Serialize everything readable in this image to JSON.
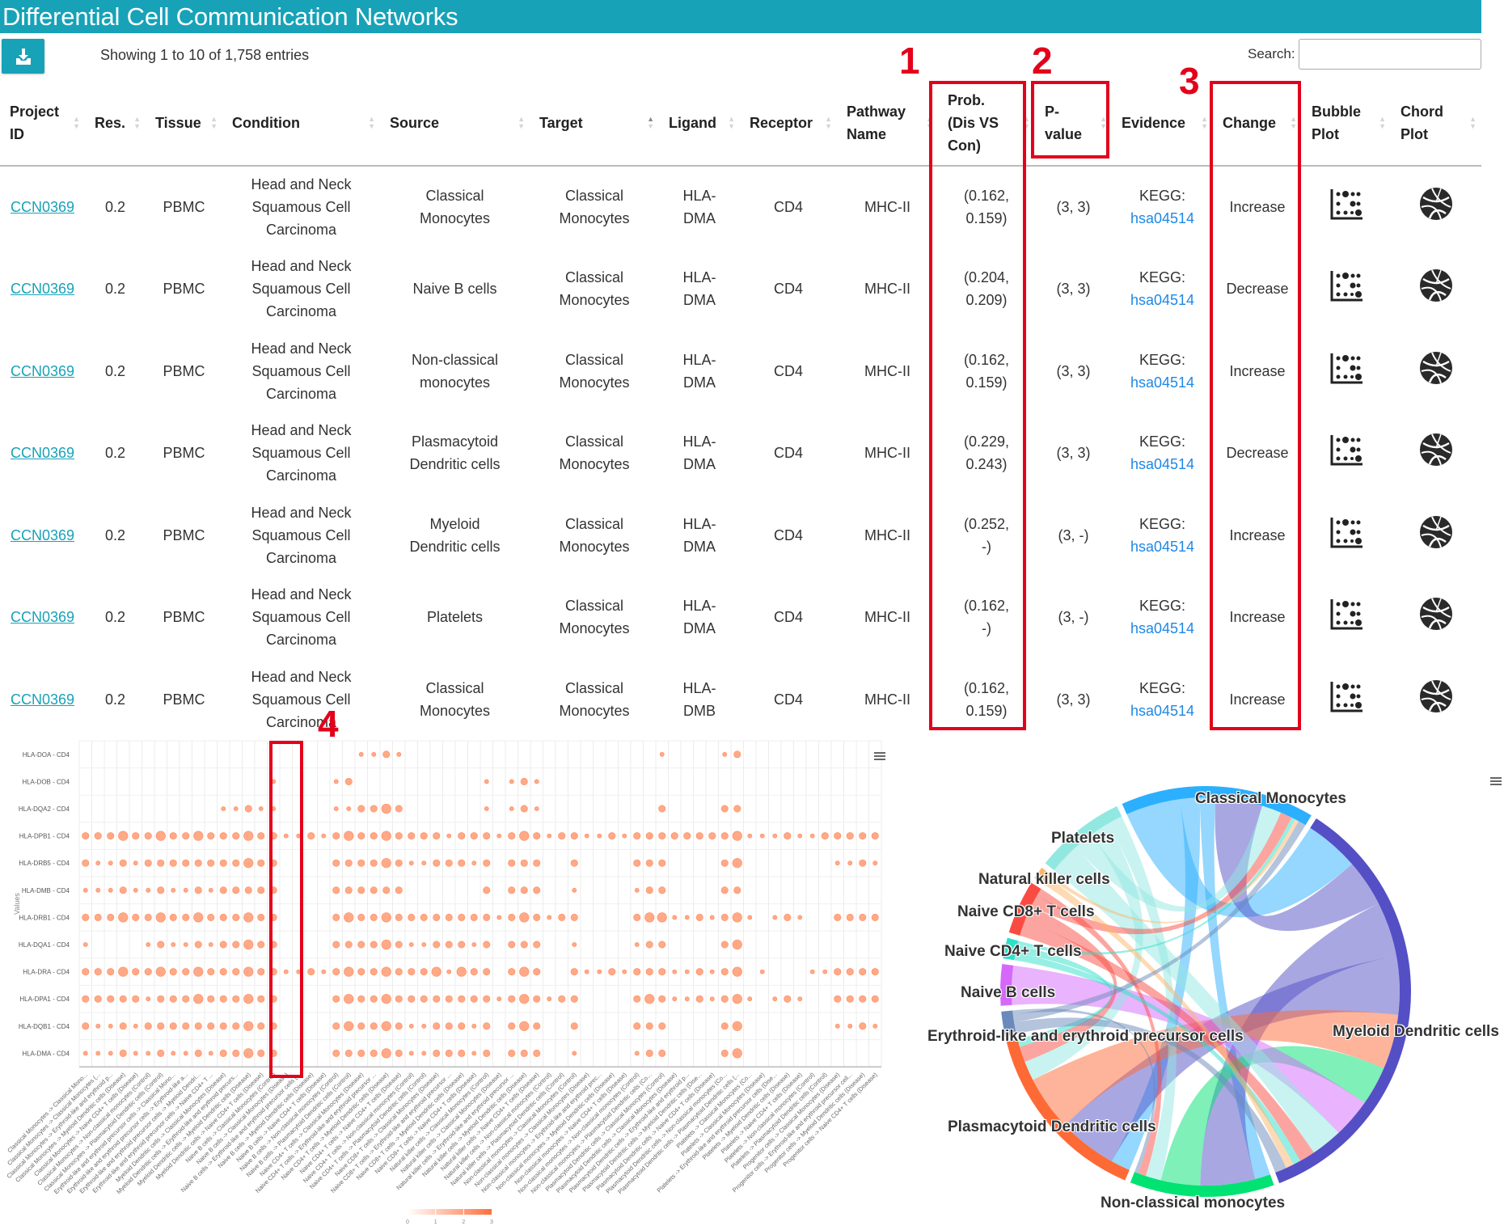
{
  "header": {
    "title": "Differential Cell Communication Networks"
  },
  "toolbar": {
    "download_icon": "download-icon",
    "info": "Showing 1 to 10 of 1,758 entries",
    "search_label": "Search:",
    "search_value": ""
  },
  "table": {
    "columns": [
      "Project ID",
      "Res.",
      "Tissue",
      "Condition",
      "Source",
      "Target",
      "Ligand",
      "Receptor",
      "Pathway Name",
      "Prob. (Dis VS Con)",
      "P-value",
      "Evidence",
      "Change",
      "Bubble Plot",
      "Chord Plot"
    ],
    "sorted_column": "Target",
    "sort_direction": "ascending",
    "rows": [
      {
        "project_id": "CCN0369",
        "res": "0.2",
        "tissue": "PBMC",
        "condition": "Head and Neck Squamous Cell Carcinoma",
        "source": "Classical Monocytes",
        "target": "Classical Monocytes",
        "ligand": "HLA-DMA",
        "receptor": "CD4",
        "pathway": "MHC-II",
        "prob": "(0.162, 0.159)",
        "pvalue": "(3, 3)",
        "evidence_prefix": "KEGG:",
        "evidence_link": "hsa04514",
        "change": "Increase"
      },
      {
        "project_id": "CCN0369",
        "res": "0.2",
        "tissue": "PBMC",
        "condition": "Head and Neck Squamous Cell Carcinoma",
        "source": "Naive B cells",
        "target": "Classical Monocytes",
        "ligand": "HLA-DMA",
        "receptor": "CD4",
        "pathway": "MHC-II",
        "prob": "(0.204, 0.209)",
        "pvalue": "(3, 3)",
        "evidence_prefix": "KEGG:",
        "evidence_link": "hsa04514",
        "change": "Decrease"
      },
      {
        "project_id": "CCN0369",
        "res": "0.2",
        "tissue": "PBMC",
        "condition": "Head and Neck Squamous Cell Carcinoma",
        "source": "Non-classical monocytes",
        "target": "Classical Monocytes",
        "ligand": "HLA-DMA",
        "receptor": "CD4",
        "pathway": "MHC-II",
        "prob": "(0.162, 0.159)",
        "pvalue": "(3, 3)",
        "evidence_prefix": "KEGG:",
        "evidence_link": "hsa04514",
        "change": "Increase"
      },
      {
        "project_id": "CCN0369",
        "res": "0.2",
        "tissue": "PBMC",
        "condition": "Head and Neck Squamous Cell Carcinoma",
        "source": "Plasmacytoid Dendritic cells",
        "target": "Classical Monocytes",
        "ligand": "HLA-DMA",
        "receptor": "CD4",
        "pathway": "MHC-II",
        "prob": "(0.229, 0.243)",
        "pvalue": "(3, 3)",
        "evidence_prefix": "KEGG:",
        "evidence_link": "hsa04514",
        "change": "Decrease"
      },
      {
        "project_id": "CCN0369",
        "res": "0.2",
        "tissue": "PBMC",
        "condition": "Head and Neck Squamous Cell Carcinoma",
        "source": "Myeloid Dendritic cells",
        "target": "Classical Monocytes",
        "ligand": "HLA-DMA",
        "receptor": "CD4",
        "pathway": "MHC-II",
        "prob": "(0.252, -)",
        "pvalue": "(3, -)",
        "evidence_prefix": "KEGG:",
        "evidence_link": "hsa04514",
        "change": "Increase"
      },
      {
        "project_id": "CCN0369",
        "res": "0.2",
        "tissue": "PBMC",
        "condition": "Head and Neck Squamous Cell Carcinoma",
        "source": "Platelets",
        "target": "Classical Monocytes",
        "ligand": "HLA-DMA",
        "receptor": "CD4",
        "pathway": "MHC-II",
        "prob": "(0.162, -)",
        "pvalue": "(3, -)",
        "evidence_prefix": "KEGG:",
        "evidence_link": "hsa04514",
        "change": "Increase"
      },
      {
        "project_id": "CCN0369",
        "res": "0.2",
        "tissue": "PBMC",
        "condition": "Head and Neck Squamous Cell Carcinoma",
        "source": "Classical Monocytes",
        "target": "Classical Monocytes",
        "ligand": "HLA-DMB",
        "receptor": "CD4",
        "pathway": "MHC-II",
        "prob": "(0.162, 0.159)",
        "pvalue": "(3, 3)",
        "evidence_prefix": "KEGG:",
        "evidence_link": "hsa04514",
        "change": "Increase"
      }
    ],
    "row_icons": {
      "bubble": "bubble-plot-icon",
      "chord": "chord-plot-icon"
    }
  },
  "annotations": {
    "labels": [
      "1",
      "2",
      "3",
      "4"
    ],
    "color": "#e3001b"
  },
  "chart_data": [
    {
      "type": "scatter",
      "subtype": "bubble",
      "ylabel": "Values",
      "bubble_color": "#ffa07a",
      "colorbar": {
        "ticks": [
          "0",
          "1",
          "2",
          "3"
        ],
        "range": [
          0,
          3
        ],
        "color_low": "#ffffff",
        "color_high": "#ff6f3c"
      },
      "grid": true,
      "y_categories": [
        "HLA-DOA - CD4",
        "HLA-DOB - CD4",
        "HLA-DQA2 - CD4",
        "HLA-DPB1 - CD4",
        "HLA-DRB5 - CD4",
        "HLA-DMB - CD4",
        "HLA-DRB1 - CD4",
        "HLA-DQA1 - CD4",
        "HLA-DRA - CD4",
        "HLA-DPA1 - CD4",
        "HLA-DQB1 - CD4",
        "HLA-DMA - CD4"
      ],
      "x_categories": [
        "Classical Monocytes -> Classical Mono...",
        "Classical Monocytes -> Classical Monocytes (...",
        "Classical Monocytes -> Erythroid-like and erythroid p...",
        "Classical Monocytes -> Myeloid Dendritic cells (Disease)",
        "Classical Monocytes -> Naive CD4+ T cells (Disease)",
        "Classical Monocytes -> Non-classical monocytes (Control)",
        "Classical Monocytes -> Plasmacytoid Dendritic cells (Control)",
        "Erythroid-like and erythroid precursor cells -> Classical Mono...",
        "Erythroid-like and erythroid precursor cells -> Erythroid-like a...",
        "Erythroid-like and erythroid precursor cells -> Myeloid Dendri...",
        "Erythroid-like and erythroid precursor cells -> Naive CD4+ T ...",
        "Myeloid Dendritic cells -> Classical Monocytes (Disease)",
        "Myeloid Dendritic cells -> Erythroid-like and erythroid precurs...",
        "Myeloid Dendritic cells -> Myeloid Dendritic cells (Disease)",
        "Myeloid Dendritic cells -> Naive CD4+ T cells (Disease)",
        "Naive B cells -> Classical Monocytes (Control)",
        "Naive B cells -> Classical Monocytes (Disease)",
        "Naive B cells -> Erythroid-like and erythroid precursor cells (...",
        "Naive B cells -> Myeloid Dendritic cells (Disease)",
        "Naive B cells -> Naive CD4+ T cells (Disease)",
        "Naive B cells -> Non-classical monocytes (Control)",
        "Naive B cells -> Plasmacytoid Dendritic cells (Control)",
        "Naive CD4+ T cells -> Classical Monocytes (Disease)",
        "Naive CD4+ T cells -> Erythroid-like and erythroid precursor ...",
        "Naive CD4+ T cells -> Myeloid Dendritic cells (Disease)",
        "Naive CD4+ T cells -> Naive CD4+ T cells (Disease)",
        "Naive CD4+ T cells -> Non-classical monocytes (Control)",
        "Naive CD4+ T cells -> Plasmacytoid Dendritic cells (Control)",
        "Naive CD8+ T cells -> Classical Monocytes (Disease)",
        "Naive CD8+ T cells -> Erythroid-like and erythroid precursor ...",
        "Naive CD8+ T cells -> Myeloid Dendritic cells (Disease)",
        "Naive CD8+ T cells -> Naive CD4+ T cells (Disease)",
        "Natural killer cells -> Classical Monocytes (Control)",
        "Natural killer cells -> Classical Monocytes (Disease)",
        "Natural killer cells -> Erythroid-like and erythroid precursor ...",
        "Natural killer cells -> Myeloid Dendritic cells (Disease)",
        "Natural killer cells -> Naive CD4+ T cells (Disease)",
        "Natural killer cells -> Non-classical monocytes (Control)",
        "Natural killer cells -> Plasmacytoid Dendritic cells (Control)",
        "Non-classical monocytes -> Classical Monocytes (Control)",
        "Non-classical monocytes -> Classical Monocytes (Disease)",
        "Non-classical monocytes -> Erythroid-like and erythroid prec...",
        "Non-classical monocytes -> Myeloid Dendritic cells (Disease)",
        "Non-classical monocytes -> Naive CD4+ T cells (Disease)",
        "Non-classical monocytes -> Non-classical monocytes (Control)",
        "Non-classical monocytes -> Plasmacytoid Dendritic cells (Co...",
        "Plasmacytoid Dendritic cells -> Classical Monocytes (Control)",
        "Plasmacytoid Dendritic cells -> Classical Monocytes (Disease)",
        "Plasmacytoid Dendritic cells -> Erythroid-like and erythroid p...",
        "Plasmacytoid Dendritic cells -> Myeloid Dendritic cells (Dise...",
        "Plasmacytoid Dendritic cells -> Naive CD4+ T cells (Disease)",
        "Plasmacytoid Dendritic cells -> Non-classical monocytes (Co...",
        "Plasmacytoid Dendritic cells -> Plasmacytoid Dendritic cells (...",
        "Platelets -> Classical Monocytes (Co...",
        "Platelets -> Classical Monocytes (Disease)",
        "Platelets -> Erythroid-like and erythroid precursor cells (Dise...",
        "Platelets -> Myeloid Dendritic cells (Disease)",
        "Platelets -> Naive CD4+ T cells (Disease)",
        "Platelets -> Non-classical monocytes (Control)",
        "Platelets -> Plasmacytoid Dendritic cells (Control)",
        "Progenitor cells -> Classical Monocytes (Disease)",
        "Progenitor cells -> Erythroid-like and erythroid precursor cell...",
        "Progenitor cells -> Myeloid Dendritic cells (Disease)",
        "Progenitor cells -> Naive CD4+ T cells (Disease)"
      ],
      "bubble_levels": [
        "0000000000000000000000112100000000000000000000100001200000000000",
        "0000000000000001000012000000000010121000000000000000000000000000",
        "0000000000011211000011223200000010121000000000200002200000000000",
        "2223223223222322112123223222212221232122112122222222311121122222",
        "2112122222222322000022223211222120222002000022200002300000001121",
        "1112112112122222000022222200000020222001000012200002200000000000",
        "2223223223222322000023223222222221232122000023311212310121002222",
        "1000012112122322000022223211222120222001000012200002300000000000",
        "2223223223222322112123223222313220232002112122211212301000112222",
        "2222212223222322000023223222222221232122000023211212310121002222",
        "2112122222222322000023223211222120232002000022200002300000001121",
        "1112112112122322000022223211222120222001000012200002300000000000"
      ]
    },
    {
      "type": "chord",
      "nodes": [
        {
          "name": "Classical Monocytes",
          "color": "#2caffe"
        },
        {
          "name": "Myeloid Dendritic cells",
          "color": "#544fc5"
        },
        {
          "name": "Non-classical monocytes",
          "color": "#00e272"
        },
        {
          "name": "Plasmacytoid Dendritic cells",
          "color": "#fe6a35"
        },
        {
          "name": "Erythroid-like and erythroid precursor cells",
          "color": "#6b8abc"
        },
        {
          "name": "Naive B cells",
          "color": "#d568fb"
        },
        {
          "name": "Naive CD4+ T cells",
          "color": "#2ee0ca"
        },
        {
          "name": "Naive CD8+ T cells",
          "color": "#fa4b42"
        },
        {
          "name": "Natural killer cells",
          "color": "#feb56a"
        },
        {
          "name": "Platelets",
          "color": "#91e8e1"
        }
      ],
      "links": [
        [
          "Classical Monocytes",
          "Myeloid Dendritic cells",
          14
        ],
        [
          "Classical Monocytes",
          "Plasmacytoid Dendritic cells",
          5
        ],
        [
          "Classical Monocytes",
          "Non-classical monocytes",
          4
        ],
        [
          "Myeloid Dendritic cells",
          "Classical Monocytes",
          12
        ],
        [
          "Myeloid Dendritic cells",
          "Non-classical monocytes",
          14
        ],
        [
          "Myeloid Dendritic cells",
          "Plasmacytoid Dendritic cells",
          15
        ],
        [
          "Plasmacytoid Dendritic cells",
          "Myeloid Dendritic cells",
          14
        ],
        [
          "Non-classical monocytes",
          "Myeloid Dendritic cells",
          10
        ],
        [
          "Naive B cells",
          "Myeloid Dendritic cells",
          10
        ],
        [
          "Platelets",
          "Myeloid Dendritic cells",
          8
        ],
        [
          "Platelets",
          "Classical Monocytes",
          5
        ],
        [
          "Platelets",
          "Plasmacytoid Dendritic cells",
          5
        ],
        [
          "Platelets",
          "Non-classical monocytes",
          4
        ],
        [
          "Naive CD8+ T cells",
          "Myeloid Dendritic cells",
          4
        ],
        [
          "Naive CD8+ T cells",
          "Plasmacytoid Dendritic cells",
          4
        ],
        [
          "Naive CD8+ T cells",
          "Classical Monocytes",
          3
        ],
        [
          "Naive CD8+ T cells",
          "Non-classical monocytes",
          2
        ],
        [
          "Naive CD4+ T cells",
          "Myeloid Dendritic cells",
          2
        ],
        [
          "Naive CD4+ T cells",
          "Plasmacytoid Dendritic cells",
          2
        ],
        [
          "Naive CD4+ T cells",
          "Classical Monocytes",
          1
        ],
        [
          "Natural killer cells",
          "Myeloid Dendritic cells",
          2
        ],
        [
          "Natural killer cells",
          "Classical Monocytes",
          1
        ],
        [
          "Erythroid-like and erythroid precursor cells",
          "Myeloid Dendritic cells",
          3
        ],
        [
          "Erythroid-like and erythroid precursor cells",
          "Classical Monocytes",
          2
        ],
        [
          "Erythroid-like and erythroid precursor cells",
          "Non-classical monocytes",
          1
        ]
      ]
    }
  ],
  "chart_menu_icon": "hamburger-menu-icon"
}
